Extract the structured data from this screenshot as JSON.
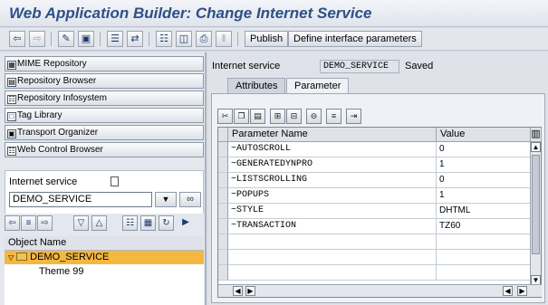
{
  "window": {
    "title": "Web Application Builder: Change Internet Service"
  },
  "toolbar": {
    "icons": [
      "back-icon",
      "forward-icon",
      "edit-icon",
      "display-change-icon",
      "object-list-icon",
      "transport-icon",
      "hierarchy-icon",
      "windows-icon",
      "print-icon",
      "pause-icon"
    ],
    "publish_label": "Publish",
    "define_params_label": "Define interface parameters"
  },
  "sidebar": {
    "nav_buttons": [
      {
        "label": "MIME Repository"
      },
      {
        "label": "Repository Browser"
      },
      {
        "label": "Repository Infosystem"
      },
      {
        "label": "Tag Library"
      },
      {
        "label": "Transport Organizer"
      },
      {
        "label": "Web Control Browser"
      }
    ],
    "service_label": "Internet service",
    "service_value": "DEMO_SERVICE",
    "tree_header": "Object Name",
    "tree_root": "DEMO_SERVICE",
    "tree_child": "Theme 99"
  },
  "main": {
    "service_label": "Internet service",
    "service_value": "DEMO_SERVICE",
    "status": "Saved",
    "tabs": [
      {
        "label": "Attributes"
      },
      {
        "label": "Parameter"
      }
    ],
    "active_tab": "Parameter",
    "grid": {
      "columns": [
        "Parameter Name",
        "Value"
      ],
      "rows": [
        {
          "name": "~AUTOSCROLL",
          "value": "0"
        },
        {
          "name": "~GENERATEDYNPRO",
          "value": "1"
        },
        {
          "name": "~LISTSCROLLING",
          "value": "0"
        },
        {
          "name": "~POPUPS",
          "value": "1"
        },
        {
          "name": "~STYLE",
          "value": "DHTML"
        },
        {
          "name": "~TRANSACTION",
          "value": "TZ60"
        }
      ]
    }
  }
}
